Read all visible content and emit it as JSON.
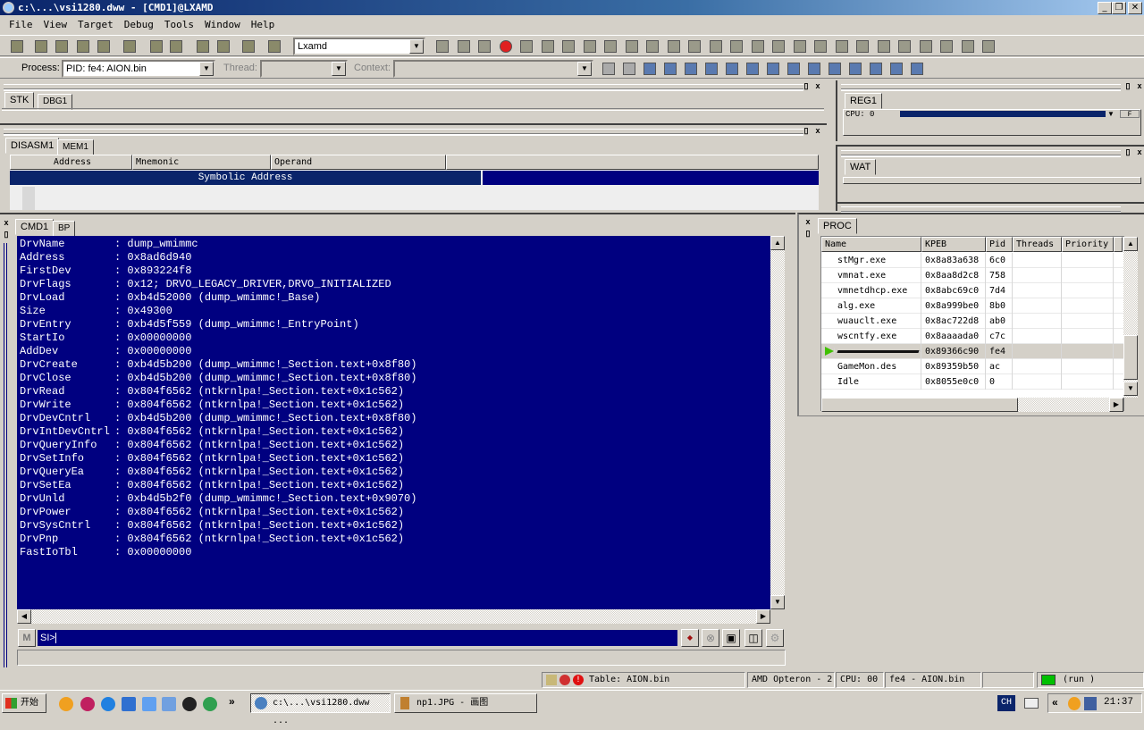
{
  "window": {
    "title": "c:\\...\\vsi1280.dww - [CMD1]@LXAMD",
    "minimize": "_",
    "restore": "❐",
    "close": "✕"
  },
  "menu": [
    "File",
    "View",
    "Target",
    "Debug",
    "Tools",
    "Window",
    "Help"
  ],
  "toolbar": {
    "target_combo": "Lxamd",
    "process_label": "Process:",
    "process_value": "PID:  fe4: AION.bin",
    "thread_label": "Thread:",
    "context_label": "Context:"
  },
  "panels": {
    "stk": {
      "tabs": [
        "STK",
        "DBG1"
      ]
    },
    "disasm": {
      "tabs": [
        "DISASM1",
        "MEM1"
      ],
      "columns": [
        "Address",
        "Mnemonic",
        "Operand"
      ],
      "symbolic_address": "Symbolic Address"
    },
    "reg": {
      "tabs": [
        "REG1"
      ],
      "cpu": "CPU: 0",
      "button": "F"
    },
    "wat": {
      "tabs": [
        "WAT"
      ]
    },
    "cmd": {
      "tabs": [
        "CMD1",
        "BP"
      ],
      "prompt": "SI>",
      "lines": [
        {
          "k": "DrvName",
          "v": ": dump_wmimmc"
        },
        {
          "k": "Address",
          "v": ": 0x8ad6d940"
        },
        {
          "k": "FirstDev",
          "v": ": 0x893224f8"
        },
        {
          "k": "DrvFlags",
          "v": ": 0x12; DRVO_LEGACY_DRIVER,DRVO_INITIALIZED"
        },
        {
          "k": "DrvLoad",
          "v": ": 0xb4d52000 (dump_wmimmc!_Base)"
        },
        {
          "k": "Size",
          "v": ": 0x49300"
        },
        {
          "k": "DrvEntry",
          "v": ": 0xb4d5f559 (dump_wmimmc!_EntryPoint)"
        },
        {
          "k": "StartIo",
          "v": ": 0x00000000"
        },
        {
          "k": "AddDev",
          "v": ": 0x00000000"
        },
        {
          "k": "DrvCreate",
          "v": ": 0xb4d5b200 (dump_wmimmc!_Section.text+0x8f80)"
        },
        {
          "k": "DrvClose",
          "v": ": 0xb4d5b200 (dump_wmimmc!_Section.text+0x8f80)"
        },
        {
          "k": "DrvRead",
          "v": ": 0x804f6562 (ntkrnlpa!_Section.text+0x1c562)"
        },
        {
          "k": "DrvWrite",
          "v": ": 0x804f6562 (ntkrnlpa!_Section.text+0x1c562)"
        },
        {
          "k": "DrvDevCntrl",
          "v": ": 0xb4d5b200 (dump_wmimmc!_Section.text+0x8f80)"
        },
        {
          "k": "DrvIntDevCntrl",
          "v": ": 0x804f6562 (ntkrnlpa!_Section.text+0x1c562)"
        },
        {
          "k": "DrvQueryInfo",
          "v": ": 0x804f6562 (ntkrnlpa!_Section.text+0x1c562)"
        },
        {
          "k": "DrvSetInfo",
          "v": ": 0x804f6562 (ntkrnlpa!_Section.text+0x1c562)"
        },
        {
          "k": "DrvQueryEa",
          "v": ": 0x804f6562 (ntkrnlpa!_Section.text+0x1c562)"
        },
        {
          "k": "DrvSetEa",
          "v": ": 0x804f6562 (ntkrnlpa!_Section.text+0x1c562)"
        },
        {
          "k": "DrvUnld",
          "v": ": 0xb4d5b2f0 (dump_wmimmc!_Section.text+0x9070)"
        },
        {
          "k": "DrvPower",
          "v": ": 0x804f6562 (ntkrnlpa!_Section.text+0x1c562)"
        },
        {
          "k": "DrvSysCntrl",
          "v": ": 0x804f6562 (ntkrnlpa!_Section.text+0x1c562)"
        },
        {
          "k": "DrvPnp",
          "v": ": 0x804f6562 (ntkrnlpa!_Section.text+0x1c562)"
        },
        {
          "k": "FastIoTbl",
          "v": ": 0x00000000"
        }
      ]
    },
    "proc": {
      "tabs": [
        "PROC"
      ],
      "columns": [
        "Name",
        "KPEB",
        "Pid",
        "Threads",
        "Priority"
      ],
      "rows": [
        {
          "name": "stMgr.exe",
          "kpeb": "0x8a83a638",
          "pid": "6c0"
        },
        {
          "name": "vmnat.exe",
          "kpeb": "0x8aa8d2c8",
          "pid": "758"
        },
        {
          "name": "vmnetdhcp.exe",
          "kpeb": "0x8abc69c0",
          "pid": "7d4"
        },
        {
          "name": "alg.exe",
          "kpeb": "0x8a999be0",
          "pid": "8b0"
        },
        {
          "name": "wuauclt.exe",
          "kpeb": "0x8ac722d8",
          "pid": "ab0"
        },
        {
          "name": "wscntfy.exe",
          "kpeb": "0x8aaaada0",
          "pid": "c7c"
        },
        {
          "name": "",
          "kpeb": "0x89366c90",
          "pid": "fe4",
          "selected": true
        },
        {
          "name": "GameMon.des",
          "kpeb": "0x89359b50",
          "pid": "ac"
        },
        {
          "name": "Idle",
          "kpeb": "0x8055e0c0",
          "pid": "0"
        }
      ]
    }
  },
  "statusbar": {
    "table": "Table: AION.bin",
    "cpu_model": "AMD Opteron - 2",
    "cpu": "CPU: 00",
    "process": "fe4 - AION.bin",
    "state": "(run )",
    "state_color": "#00c000"
  },
  "taskbar": {
    "start": "开始",
    "tasks": [
      "c:\\...\\vsi1280.dww ...",
      "np1.JPG - 画图"
    ],
    "more": "»",
    "ime": "CH",
    "tray_expand": "«",
    "clock": "21:37"
  },
  "colors": {
    "console_bg": "#000080",
    "title_start": "#0a246a"
  }
}
